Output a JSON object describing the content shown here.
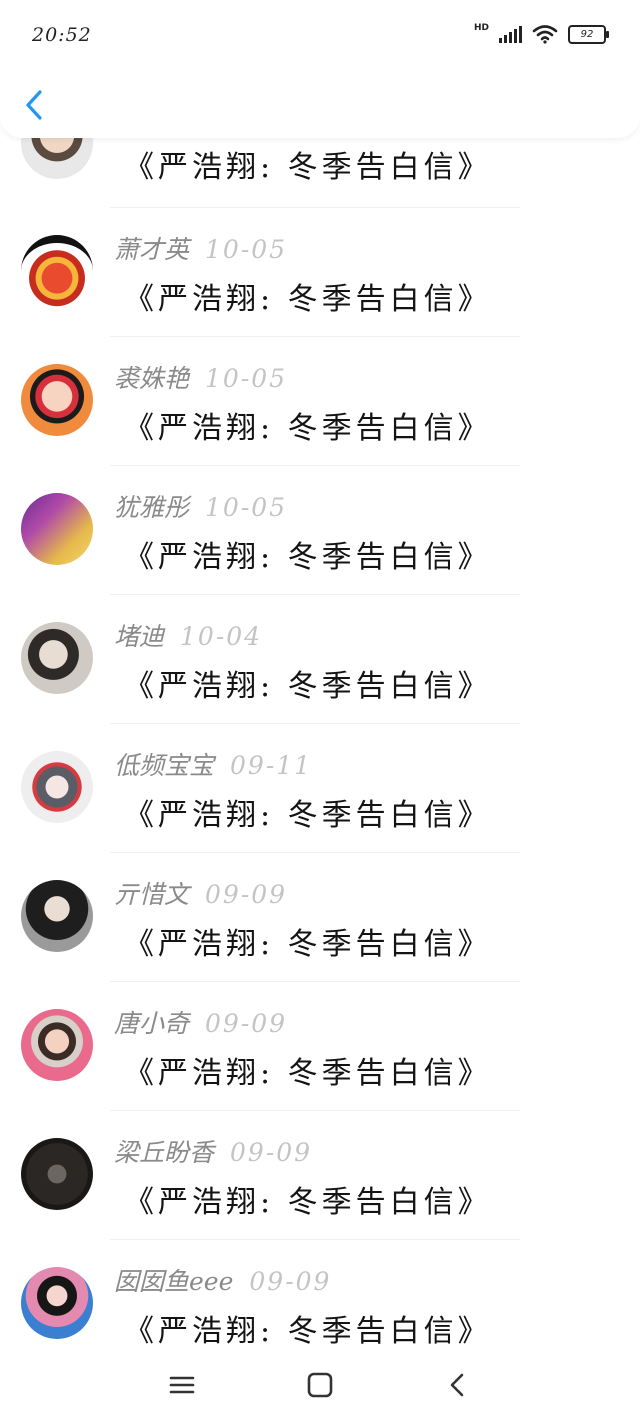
{
  "status_bar": {
    "time": "20:52",
    "network": "HD",
    "battery": "92"
  },
  "header": {
    "back_icon": "chevron-left-icon",
    "accent": "#2196f3"
  },
  "comments": [
    {
      "name": "",
      "date": "",
      "text": "《严浩翔: 冬季告白信》"
    },
    {
      "name": "萧才英",
      "date": "10-05",
      "text": "《严浩翔: 冬季告白信》"
    },
    {
      "name": "裘姝艳",
      "date": "10-05",
      "text": "《严浩翔: 冬季告白信》"
    },
    {
      "name": "犹雅彤",
      "date": "10-05",
      "text": "《严浩翔: 冬季告白信》"
    },
    {
      "name": "堵迪",
      "date": "10-04",
      "text": "《严浩翔: 冬季告白信》"
    },
    {
      "name": "低频宝宝",
      "date": "09-11",
      "text": "《严浩翔: 冬季告白信》"
    },
    {
      "name": "亓惜文",
      "date": "09-09",
      "text": "《严浩翔: 冬季告白信》"
    },
    {
      "name": "唐小奇",
      "date": "09-09",
      "text": "《严浩翔: 冬季告白信》"
    },
    {
      "name": "梁丘盼香",
      "date": "09-09",
      "text": "《严浩翔: 冬季告白信》"
    },
    {
      "name": "囡囡鱼eee",
      "date": "09-09",
      "text": "《严浩翔: 冬季告白信》"
    }
  ],
  "nav": {
    "menu_icon": "menu-icon",
    "home_icon": "home-icon",
    "back_icon": "back-icon"
  }
}
